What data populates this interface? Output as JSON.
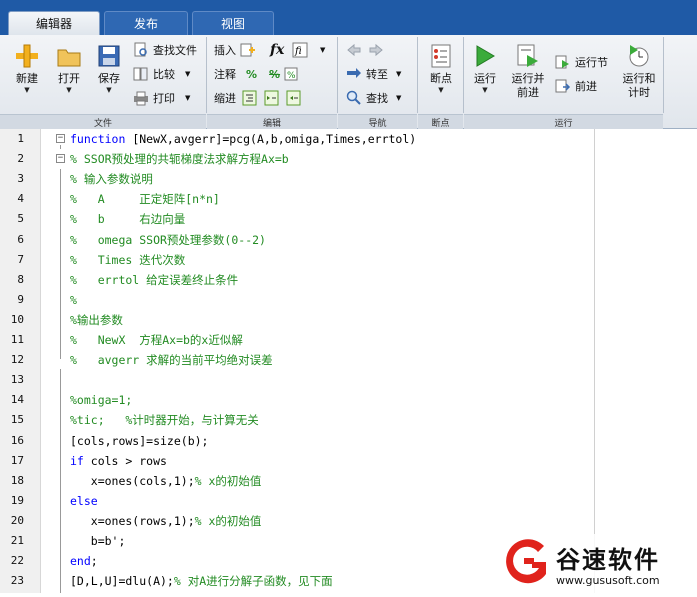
{
  "tabs": [
    {
      "label": "编辑器",
      "active": true
    },
    {
      "label": "发布",
      "active": false
    },
    {
      "label": "视图",
      "active": false
    }
  ],
  "ribbon": {
    "file": {
      "new_label": "新建",
      "open_label": "打开",
      "save_label": "保存",
      "find_files_label": "查找文件",
      "compare_label": "比较",
      "print_label": "打印",
      "group_label": "文件"
    },
    "edit": {
      "insert_label": "插入",
      "comment_label": "注释",
      "indent_label": "缩进",
      "fx_label": "fx",
      "percent_label": "%",
      "group_label": "编辑"
    },
    "navigate": {
      "goto_label": "转至",
      "find_label": "查找",
      "group_label": "导航"
    },
    "breakpoints": {
      "breakpoints_label": "断点",
      "group_label": "断点"
    },
    "run": {
      "run_label": "运行",
      "run_advance_label_1": "运行并",
      "run_advance_label_2": "前进",
      "run_section_label": "运行节",
      "advance_label": "前进",
      "run_time_label_1": "运行和",
      "run_time_label_2": "计时",
      "group_label": "运行"
    }
  },
  "code_lines": [
    {
      "n": "1",
      "code": "function [NewX,avgerr]=pcg(A,b,omiga,Times,errtol)"
    },
    {
      "n": "2",
      "code": "% SSOR预处理的共轭梯度法求解方程Ax=b"
    },
    {
      "n": "3",
      "code": "% 输入参数说明"
    },
    {
      "n": "4",
      "code": "%   A     正定矩阵[n*n]"
    },
    {
      "n": "5",
      "code": "%   b     右边向量"
    },
    {
      "n": "6",
      "code": "%   omega SSOR预处理参数(0--2)"
    },
    {
      "n": "7",
      "code": "%   Times 迭代次数"
    },
    {
      "n": "8",
      "code": "%   errtol 给定误差终止条件"
    },
    {
      "n": "9",
      "code": "%"
    },
    {
      "n": "10",
      "code": "%输出参数"
    },
    {
      "n": "11",
      "code": "%   NewX  方程Ax=b的x近似解"
    },
    {
      "n": "12",
      "code": "%   avgerr 求解的当前平均绝对误差"
    },
    {
      "n": "13",
      "code": ""
    },
    {
      "n": "14",
      "code": "%omiga=1;"
    },
    {
      "n": "15",
      "code": "%tic;   %计时器开始，与计算无关"
    },
    {
      "n": "16",
      "code": "[cols,rows]=size(b);"
    },
    {
      "n": "17",
      "code": "if cols > rows"
    },
    {
      "n": "18",
      "code": "   x=ones(cols,1);% x的初始值"
    },
    {
      "n": "19",
      "code": "else"
    },
    {
      "n": "20",
      "code": "   x=ones(rows,1);% x的初始值"
    },
    {
      "n": "21",
      "code": "   b=b';"
    },
    {
      "n": "22",
      "code": "end;"
    },
    {
      "n": "23",
      "code": "[D,L,U]=dlu(A);% 对A进行分解子函数，见下面"
    }
  ],
  "watermark": {
    "brand": "谷速软件",
    "url": "www.gususoft.com"
  }
}
